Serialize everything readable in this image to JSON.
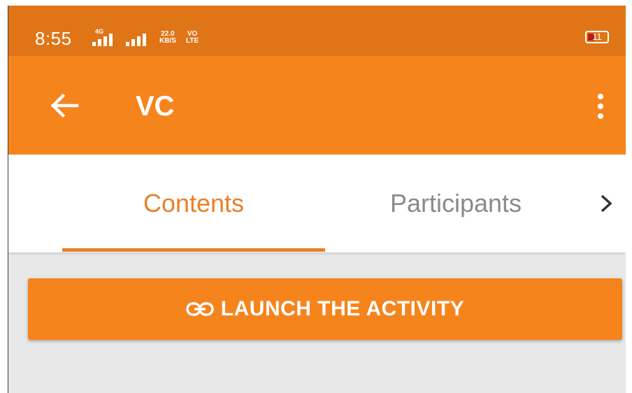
{
  "status_bar": {
    "time": "8:55",
    "signal_type": "4G",
    "net_speed_value": "22.0",
    "net_speed_unit": "KB/S",
    "volte_line1": "VO",
    "volte_line2": "LTE",
    "battery_level": "11",
    "icons": [
      "signal-icon",
      "signal-icon",
      "volte-icon",
      "battery-icon"
    ]
  },
  "app_bar": {
    "title": "VC",
    "back_icon": "arrow-left-icon",
    "menu_icon": "more-vert-icon"
  },
  "tabs": [
    {
      "label": "Contents",
      "selected": true
    },
    {
      "label": "Participants",
      "selected": false
    }
  ],
  "tab_next_icon": "chevron-right-icon",
  "launch_button": {
    "label": "LAUNCH THE ACTIVITY",
    "icon": "link-icon"
  },
  "colors": {
    "status_bar": "#e07518",
    "primary": "#f5841d",
    "tab_active": "#e8802a",
    "tab_inactive": "#8a8a8a",
    "background": "#e8e8e8"
  }
}
